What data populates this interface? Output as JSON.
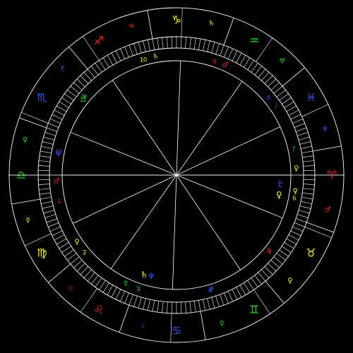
{
  "colors": {
    "background": "#000000",
    "line": "#ffffff",
    "fire": "#ff2020",
    "earth": "#ffff00",
    "air": "#22dd22",
    "water": "#3355ff"
  },
  "zodiac": [
    {
      "sign": "aries",
      "glyph": "♈",
      "color": "#ff2020"
    },
    {
      "sign": "taurus",
      "glyph": "♉",
      "color": "#ffff00"
    },
    {
      "sign": "gemini",
      "glyph": "♊",
      "color": "#22dd22"
    },
    {
      "sign": "cancer",
      "glyph": "♋",
      "color": "#3355ff"
    },
    {
      "sign": "leo",
      "glyph": "♌",
      "color": "#ff2020"
    },
    {
      "sign": "virgo",
      "glyph": "♍",
      "color": "#ffff00"
    },
    {
      "sign": "libra",
      "glyph": "♎",
      "color": "#22dd22"
    },
    {
      "sign": "scorpio",
      "glyph": "♏",
      "color": "#3355ff"
    },
    {
      "sign": "sagittarius",
      "glyph": "♐",
      "color": "#ff2020"
    },
    {
      "sign": "capricorn",
      "glyph": "♑",
      "color": "#ffff00"
    },
    {
      "sign": "aquarius",
      "glyph": "♒",
      "color": "#22dd22"
    },
    {
      "sign": "pisces",
      "glyph": "♓",
      "color": "#3355ff"
    }
  ],
  "rulers": [
    {
      "planet": "mars",
      "glyph": "♂",
      "color": "#ff2020"
    },
    {
      "planet": "venus",
      "glyph": "♀",
      "color": "#ffff00"
    },
    {
      "planet": "mercury",
      "glyph": "☿",
      "color": "#22dd22"
    },
    {
      "planet": "moon",
      "glyph": "☽",
      "color": "#3355ff"
    },
    {
      "planet": "sun",
      "glyph": "☉",
      "color": "#ff2020"
    },
    {
      "planet": "mercury",
      "glyph": "☿",
      "color": "#ffff00"
    },
    {
      "planet": "venus",
      "glyph": "♀",
      "color": "#22dd22"
    },
    {
      "planet": "pluto",
      "glyph": "♇",
      "color": "#3355ff"
    },
    {
      "planet": "jupiter",
      "glyph": "♃",
      "color": "#ff2020"
    },
    {
      "planet": "saturn",
      "glyph": "♄",
      "color": "#ffff00"
    },
    {
      "planet": "uranus",
      "glyph": "♅",
      "color": "#22dd22"
    },
    {
      "planet": "neptune",
      "glyph": "♆",
      "color": "#3355ff"
    }
  ],
  "houses": [
    {
      "number": "1",
      "color": "#ff2020",
      "cusp_glyph": "♂",
      "cusp_color": "#ff2020",
      "glyph_deg": 183
    },
    {
      "number": "2",
      "color": "#ffff00",
      "cusp_glyph": "♀",
      "cusp_color": "#ffff00",
      "glyph_deg": 214
    },
    {
      "number": "3",
      "color": "#22dd22",
      "cusp_glyph": "☿",
      "cusp_color": "#22dd22",
      "glyph_deg": 245
    },
    {
      "number": "4",
      "color": "#3355ff",
      "cusp_glyph": "♆",
      "cusp_color": "#3355ff",
      "glyph_deg": 287
    },
    {
      "number": "5",
      "color": "#ff2020",
      "cusp_glyph": "☉",
      "cusp_color": "#ff2020",
      "glyph_deg": 320
    },
    {
      "number": "6",
      "color": "#ffff00",
      "cusp_glyph": "♀",
      "cusp_color": "#ffff00",
      "glyph_deg": 352
    },
    {
      "number": "7",
      "color": "#22dd22",
      "cusp_glyph": "♀",
      "cusp_color": "#ffff00",
      "glyph_deg": 3
    },
    {
      "number": "8",
      "color": "#3355ff",
      "cusp_glyph": "☽",
      "cusp_color": "#3355ff",
      "glyph_deg": 35
    },
    {
      "number": "9",
      "color": "#ff2020",
      "cusp_glyph": "♂",
      "cusp_color": "#ff2020",
      "glyph_deg": 66
    },
    {
      "number": "10",
      "color": "#ffff00",
      "cusp_glyph": "♄",
      "cusp_color": "#ffff00",
      "glyph_deg": 100
    },
    {
      "number": "11",
      "color": "#22dd22",
      "cusp_glyph": "♅",
      "cusp_color": "#22dd22",
      "glyph_deg": 140
    },
    {
      "number": "12",
      "color": "#3355ff",
      "cusp_glyph": "♆",
      "cusp_color": "#3355ff",
      "glyph_deg": 170
    }
  ],
  "planets": [
    {
      "name": "pluto",
      "glyph": "♇",
      "color": "#3355ff",
      "deg": 355
    },
    {
      "name": "venus",
      "glyph": "♀",
      "color": "#ffff00",
      "deg": 349
    },
    {
      "name": "saturn",
      "glyph": "♄",
      "color": "#ffff00",
      "deg": 252
    },
    {
      "name": "neptune",
      "glyph": "♆",
      "color": "#3355ff",
      "deg": 256
    }
  ]
}
